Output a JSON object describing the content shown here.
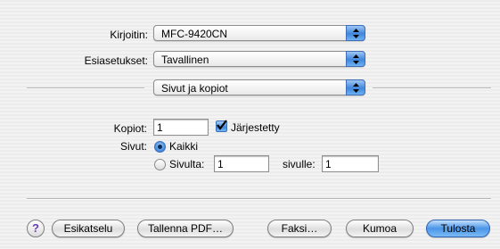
{
  "printer": {
    "label": "Kirjoitin:",
    "value": "MFC-9420CN"
  },
  "presets": {
    "label": "Esiasetukset:",
    "value": "Tavallinen"
  },
  "panel": {
    "value": "Sivut ja kopiot"
  },
  "copies": {
    "label": "Kopiot:",
    "value": "1",
    "collated_label": "Järjestetty",
    "collated": true
  },
  "pages": {
    "label": "Sivut:",
    "all_label": "Kaikki",
    "from_label": "Sivulta:",
    "from_value": "1",
    "to_label": "sivulle:",
    "to_value": "1",
    "selected": "all"
  },
  "footer": {
    "help": "?",
    "preview": "Esikatselu",
    "save_pdf": "Tallenna PDF…",
    "fax": "Faksi…",
    "cancel": "Kumoa",
    "print": "Tulosta"
  },
  "icons": {
    "popup_arrows": "up-down-arrows-icon",
    "checkmark": "checkmark-icon"
  },
  "colors": {
    "accent": "#3f86dd"
  }
}
